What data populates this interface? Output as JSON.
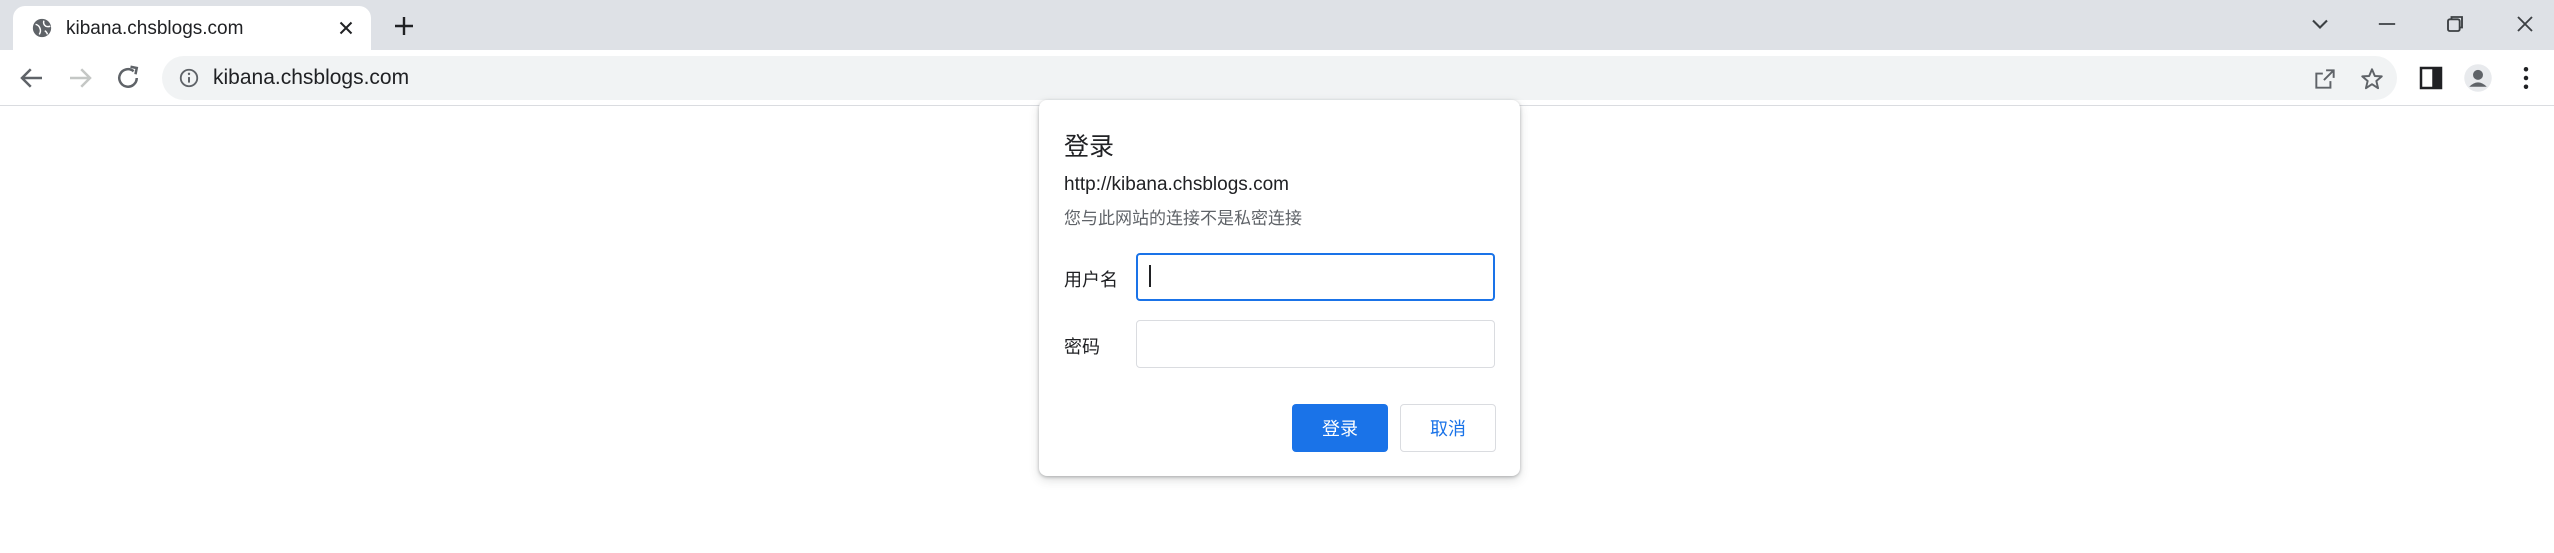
{
  "browser": {
    "tab": {
      "title": "kibana.chsblogs.com",
      "favicon": "globe-icon"
    },
    "toolbar": {
      "url": "kibana.chsblogs.com",
      "icons": [
        "back-icon",
        "forward-icon",
        "reload-icon",
        "info-icon",
        "share-icon",
        "star-icon",
        "side-panel-icon",
        "profile-icon",
        "more-icon"
      ]
    },
    "window_controls": [
      "tab-search-icon",
      "minimize-icon",
      "restore-icon",
      "close-icon"
    ]
  },
  "dialog": {
    "title": "登录",
    "origin": "http://kibana.chsblogs.com",
    "warning": "您与此网站的连接不是私密连接",
    "username_label": "用户名",
    "username_value": "",
    "password_label": "密码",
    "password_value": "",
    "submit_label": "登录",
    "cancel_label": "取消"
  },
  "colors": {
    "accent": "#1a73e8",
    "tabstrip": "#dee1e6",
    "omnibox": "#f1f3f4"
  }
}
